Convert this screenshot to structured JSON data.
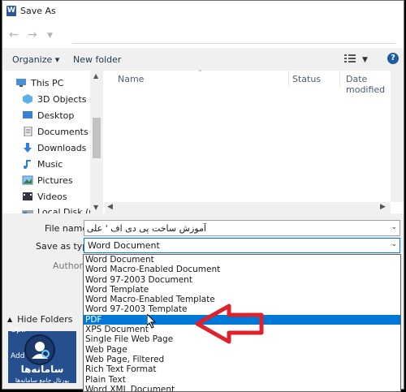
{
  "window": {
    "title": "Save As",
    "app_icon": "word-icon"
  },
  "nav": {
    "back_icon": "left-arrow-icon",
    "forward_icon": "right-arrow-icon"
  },
  "toolbar": {
    "organize": "Organize ▾",
    "new_folder": "New folder",
    "view_icon": "view-list-icon",
    "help": "?"
  },
  "sidebar": {
    "items": [
      {
        "label": "This PC",
        "icon": "computer-icon"
      },
      {
        "label": "3D Objects",
        "icon": "cube-icon"
      },
      {
        "label": "Desktop",
        "icon": "desktop-icon"
      },
      {
        "label": "Documents",
        "icon": "documents-icon"
      },
      {
        "label": "Downloads",
        "icon": "downloads-icon"
      },
      {
        "label": "Music",
        "icon": "music-icon"
      },
      {
        "label": "Pictures",
        "icon": "pictures-icon"
      },
      {
        "label": "Videos",
        "icon": "videos-icon"
      },
      {
        "label": "Local Disk (C:)",
        "icon": "disk-icon"
      }
    ]
  },
  "columns": {
    "name": "Name",
    "status": "Status",
    "date_modified": "Date modified"
  },
  "form": {
    "file_name_label": "File name:",
    "file_name_value": "آموزش ساخت پی دی اف ' علی",
    "save_type_label": "Save as type:",
    "save_type_value": "Word Document",
    "authors_label": "Authors:",
    "hide_folders": "Hide Folders"
  },
  "dropdown": {
    "options": [
      "Word Document",
      "Word Macro-Enabled Document",
      "Word 97-2003 Document",
      "Word Template",
      "Word Macro-Enabled Template",
      "Word 97-2003 Template",
      "PDF",
      "XPS Document",
      "Single File Web Page",
      "Web Page",
      "Web Page, Filtered",
      "Rich Text Format",
      "Plain Text",
      "Word XML Document"
    ],
    "selected": "PDF"
  },
  "watermark": {
    "title": "سامانه‌ها",
    "subtitle": "پورتال جامع سامانه‌ها",
    "peek_1": "Opti",
    "peek_2": "Add"
  },
  "colors": {
    "accent": "#0078d7",
    "arrow": "#e0202a",
    "logo_bg": "#254f8d"
  }
}
